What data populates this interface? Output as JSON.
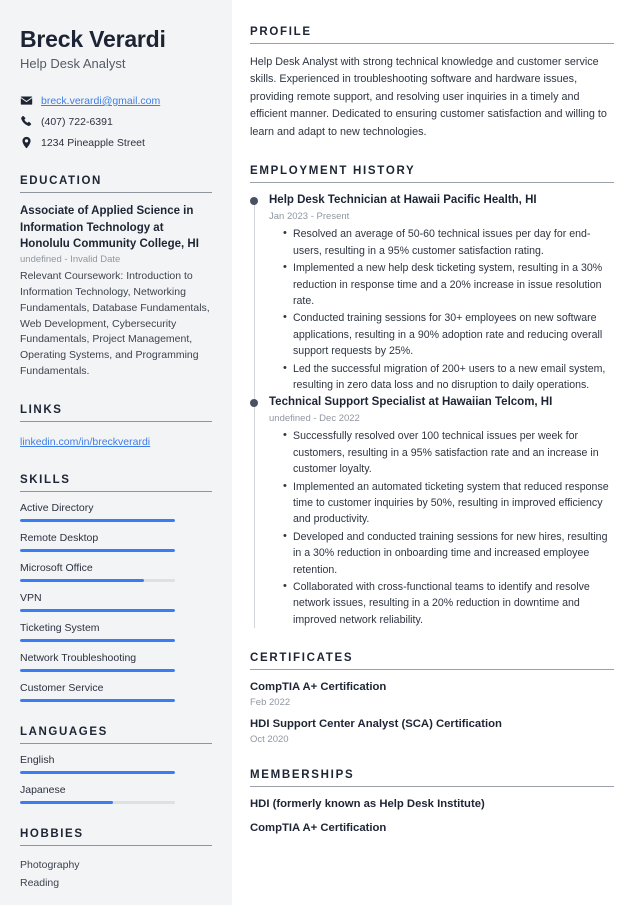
{
  "theme": {
    "sidebar_bg": "#f3f4f5",
    "accent": "#3b7df0",
    "link": "#3f7ee8",
    "heading": "#1d2433",
    "muted": "#9097a1"
  },
  "header": {
    "name": "Breck Verardi",
    "job_title": "Help Desk Analyst",
    "contacts": [
      {
        "icon": "envelope-icon",
        "text": "breck.verardi@gmail.com",
        "is_link": true
      },
      {
        "icon": "phone-icon",
        "text": "(407) 722-6391",
        "is_link": false
      },
      {
        "icon": "location-pin-icon",
        "text": "1234 Pineapple Street",
        "is_link": false
      }
    ]
  },
  "sidebar": {
    "education": {
      "heading": "EDUCATION",
      "items": [
        {
          "title": "Associate of Applied Science in Information Technology at Honolulu Community College, HI",
          "date": "undefined - Invalid Date",
          "description": "Relevant Coursework: Introduction to Information Technology, Networking Fundamentals, Database Fundamentals, Web Development, Cybersecurity Fundamentals, Project Management, Operating Systems, and Programming Fundamentals."
        }
      ]
    },
    "links": {
      "heading": "LINKS",
      "items": [
        {
          "label": "linkedin.com/in/breckverardi"
        }
      ]
    },
    "skills": {
      "heading": "SKILLS",
      "items": [
        {
          "label": "Active Directory",
          "level": 100
        },
        {
          "label": "Remote Desktop",
          "level": 100
        },
        {
          "label": "Microsoft Office",
          "level": 80
        },
        {
          "label": "VPN",
          "level": 100
        },
        {
          "label": "Ticketing System",
          "level": 100
        },
        {
          "label": "Network Troubleshooting",
          "level": 100
        },
        {
          "label": "Customer Service",
          "level": 100
        }
      ]
    },
    "languages": {
      "heading": "LANGUAGES",
      "items": [
        {
          "label": "English",
          "level": 100
        },
        {
          "label": "Japanese",
          "level": 60
        }
      ]
    },
    "hobbies": {
      "heading": "HOBBIES",
      "items": [
        {
          "label": "Photography"
        },
        {
          "label": "Reading"
        }
      ]
    }
  },
  "main": {
    "profile": {
      "heading": "PROFILE",
      "text": "Help Desk Analyst with strong technical knowledge and customer service skills. Experienced in troubleshooting software and hardware issues, providing remote support, and resolving user inquiries in a timely and efficient manner. Dedicated to ensuring customer satisfaction and willing to learn and adapt to new technologies."
    },
    "employment": {
      "heading": "EMPLOYMENT HISTORY",
      "jobs": [
        {
          "title": "Help Desk Technician at Hawaii Pacific Health, HI",
          "date": "Jan 2023 - Present",
          "bullets": [
            "Resolved an average of 50-60 technical issues per day for end-users, resulting in a 95% customer satisfaction rating.",
            "Implemented a new help desk ticketing system, resulting in a 30% reduction in response time and a 20% increase in issue resolution rate.",
            "Conducted training sessions for 30+ employees on new software applications, resulting in a 90% adoption rate and reducing overall support requests by 25%.",
            "Led the successful migration of 200+ users to a new email system, resulting in zero data loss and no disruption to daily operations."
          ]
        },
        {
          "title": "Technical Support Specialist at Hawaiian Telcom, HI",
          "date": "undefined - Dec 2022",
          "bullets": [
            "Successfully resolved over 100 technical issues per week for customers, resulting in a 95% satisfaction rate and an increase in customer loyalty.",
            "Implemented an automated ticketing system that reduced response time to customer inquiries by 50%, resulting in improved efficiency and productivity.",
            "Developed and conducted training sessions for new hires, resulting in a 30% reduction in onboarding time and increased employee retention.",
            "Collaborated with cross-functional teams to identify and resolve network issues, resulting in a 20% reduction in downtime and improved network reliability."
          ]
        }
      ]
    },
    "certificates": {
      "heading": "CERTIFICATES",
      "items": [
        {
          "title": "CompTIA A+ Certification",
          "date": "Feb 2022"
        },
        {
          "title": "HDI Support Center Analyst (SCA) Certification",
          "date": "Oct 2020"
        }
      ]
    },
    "memberships": {
      "heading": "MEMBERSHIPS",
      "items": [
        {
          "title": "HDI (formerly known as Help Desk Institute)"
        },
        {
          "title": "CompTIA A+ Certification"
        }
      ]
    }
  }
}
